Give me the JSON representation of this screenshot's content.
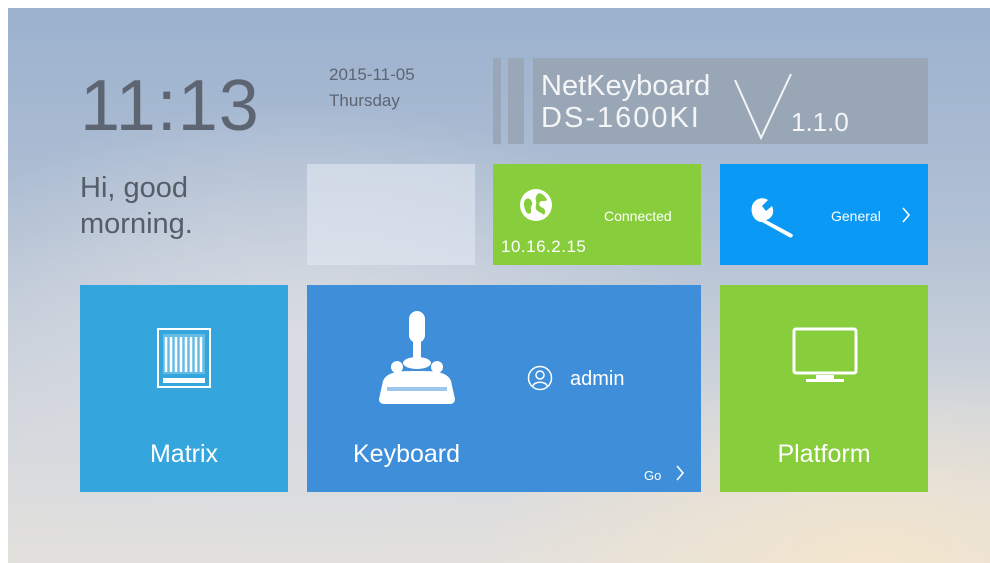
{
  "clock": {
    "time": "11:13",
    "date": "2015-11-05",
    "weekday": "Thursday"
  },
  "greeting": {
    "line1": "Hi, good",
    "line2": "morning."
  },
  "brand": {
    "name": "NetKeyboard",
    "model": "DS-1600KI",
    "version": "1.1.0"
  },
  "network_tile": {
    "status": "Connected",
    "ip": "10.16.2.15",
    "icon": "globe-icon",
    "color": "#87cd3c"
  },
  "general_tile": {
    "label": "General",
    "icon": "wrench-icon",
    "color": "#0a99f4"
  },
  "matrix_tile": {
    "label": "Matrix",
    "icon": "matrix-icon",
    "color": "#35a6dd"
  },
  "keyboard_tile": {
    "label": "Keyboard",
    "user": "admin",
    "go_label": "Go",
    "icon": "joystick-icon",
    "color": "#3e8ed9"
  },
  "platform_tile": {
    "label": "Platform",
    "icon": "monitor-icon",
    "color": "#87cd3c"
  }
}
